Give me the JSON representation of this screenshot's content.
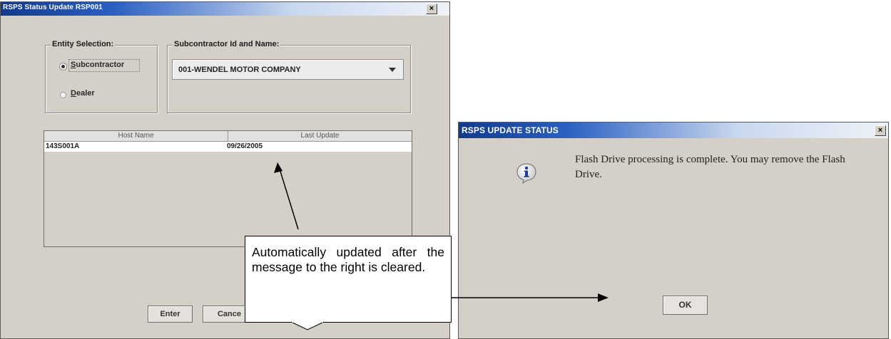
{
  "main_window": {
    "title": "RSPS Status Update     RSP001",
    "close_glyph": "×",
    "entity_selection": {
      "label": "Entity Selection:",
      "options": [
        {
          "before": "",
          "mnemonic": "S",
          "after": "ubcontractor",
          "selected": true
        },
        {
          "before": "",
          "mnemonic": "D",
          "after": "ealer",
          "selected": false
        }
      ]
    },
    "subcontractor": {
      "label": "Subcontractor Id and Name:",
      "selected_value": "001-WENDEL MOTOR COMPANY"
    },
    "table": {
      "columns": [
        "Host Name",
        "Last Update"
      ],
      "rows": [
        {
          "host_name": "143S001A",
          "last_update": "09/26/2005"
        }
      ]
    },
    "buttons": {
      "enter": "Enter",
      "cancel": "Cance"
    }
  },
  "callout": {
    "text": "Automatically updated after the message to the right is cleared."
  },
  "dialog": {
    "title": "RSPS UPDATE STATUS",
    "close_glyph": "×",
    "icon": "info-icon",
    "message": "Flash Drive processing is complete. You may remove the Flash Drive.",
    "ok_label": "OK"
  }
}
